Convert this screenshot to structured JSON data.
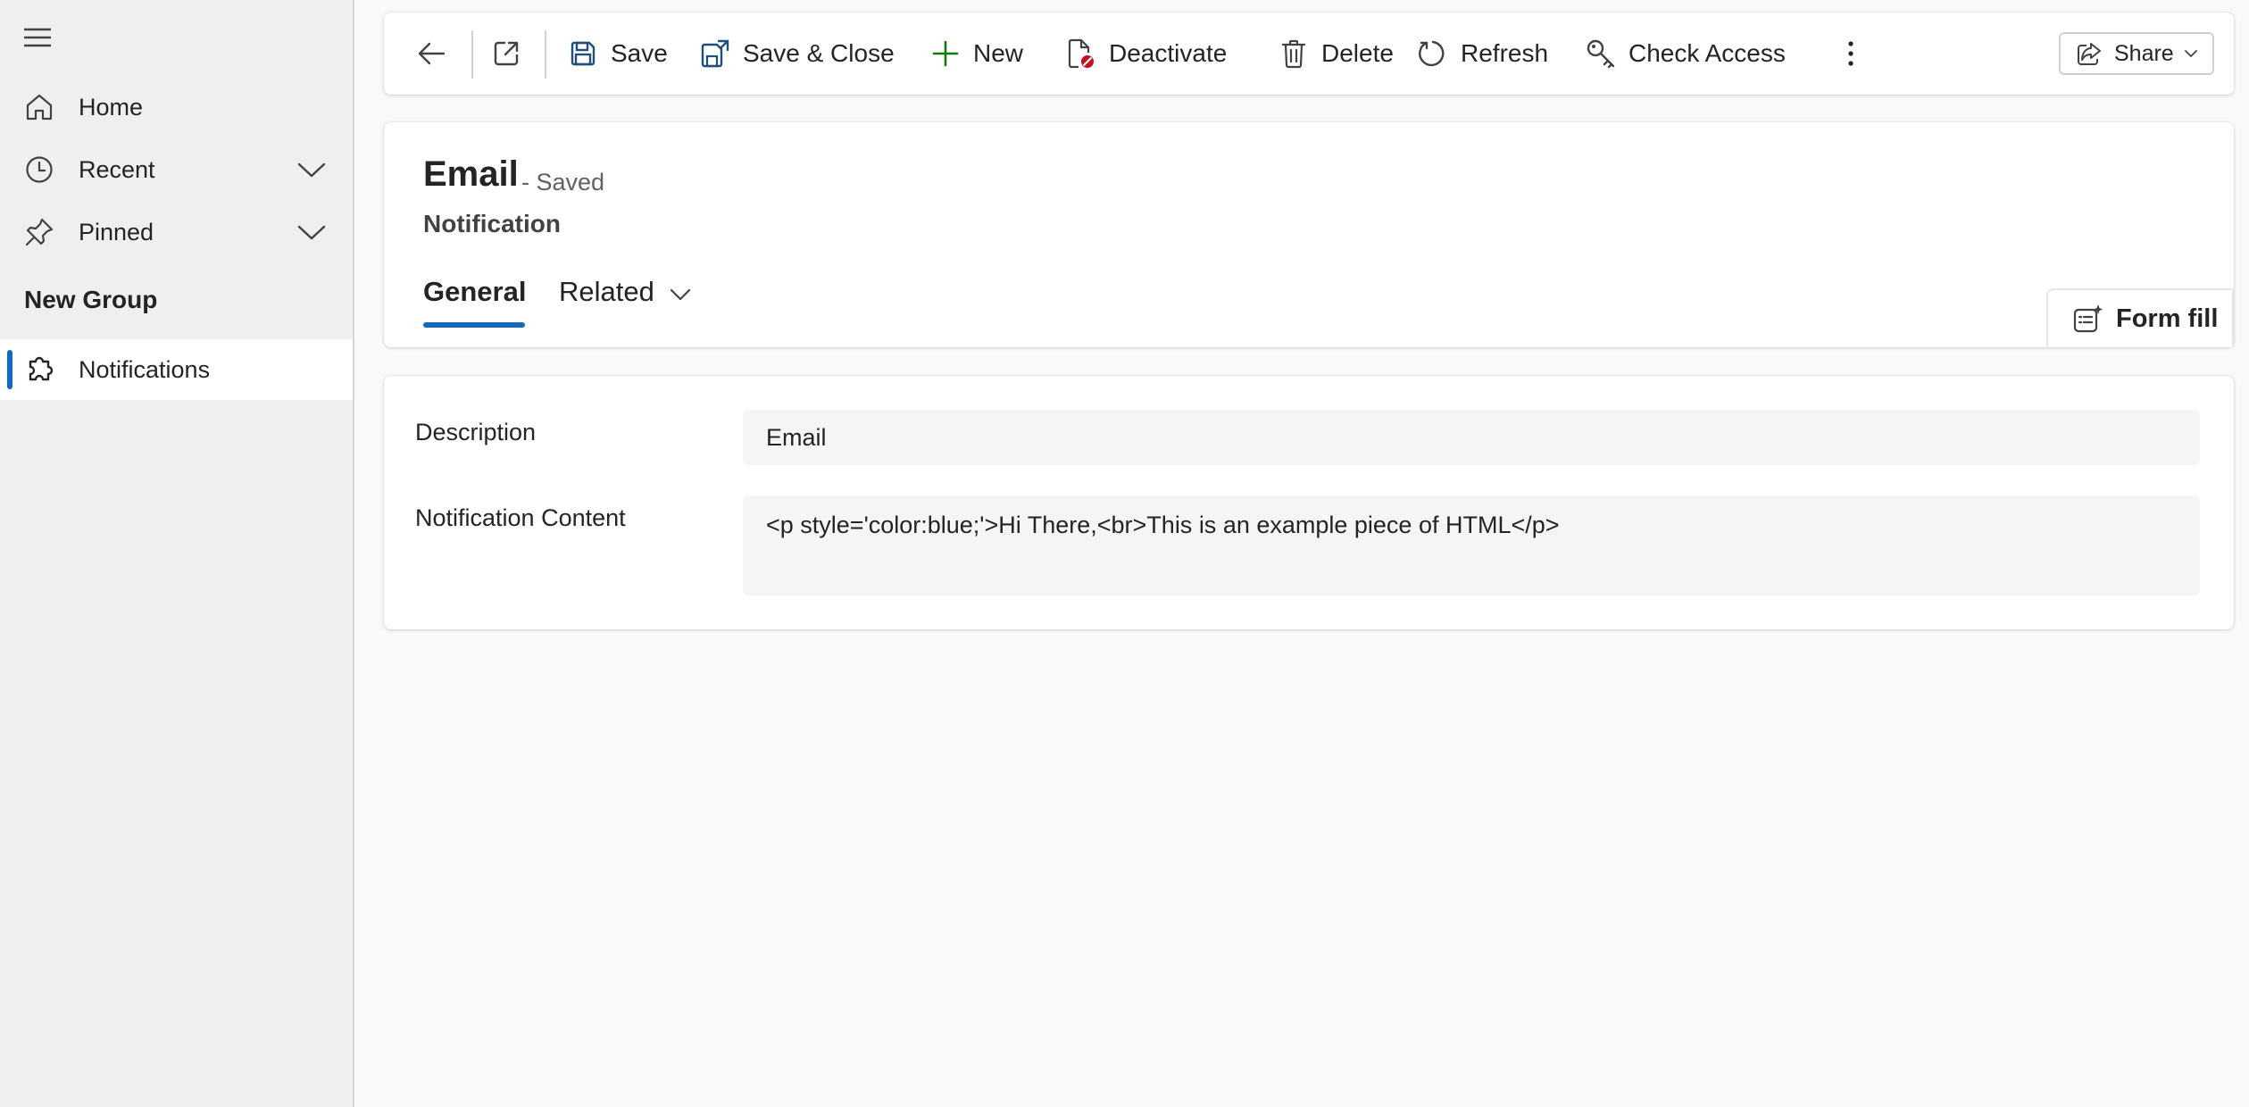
{
  "sidebar": {
    "items": [
      {
        "label": "Home",
        "icon": "home-icon"
      },
      {
        "label": "Recent",
        "icon": "clock-icon"
      },
      {
        "label": "Pinned",
        "icon": "pin-icon"
      }
    ],
    "group_title": "New Group",
    "group_items": [
      {
        "label": "Notifications",
        "icon": "puzzle-icon",
        "active": true
      }
    ]
  },
  "commandbar": {
    "save": "Save",
    "save_close": "Save & Close",
    "new": "New",
    "deactivate": "Deactivate",
    "delete": "Delete",
    "refresh": "Refresh",
    "check_access": "Check Access",
    "share": "Share"
  },
  "record": {
    "title": "Email",
    "status": "- Saved",
    "entity": "Notification"
  },
  "tabs": {
    "general": "General",
    "related": "Related"
  },
  "form_fill": "Form fill",
  "fields": {
    "description": {
      "label": "Description",
      "value": "Email"
    },
    "content": {
      "label": "Notification Content",
      "value": "<p style='color:blue;'>Hi There,<br>This is an example piece of HTML</p>"
    }
  },
  "colors": {
    "accent": "#0f6cbd",
    "new_icon": "#107c10",
    "deactivate_badge": "#c50f1f"
  }
}
